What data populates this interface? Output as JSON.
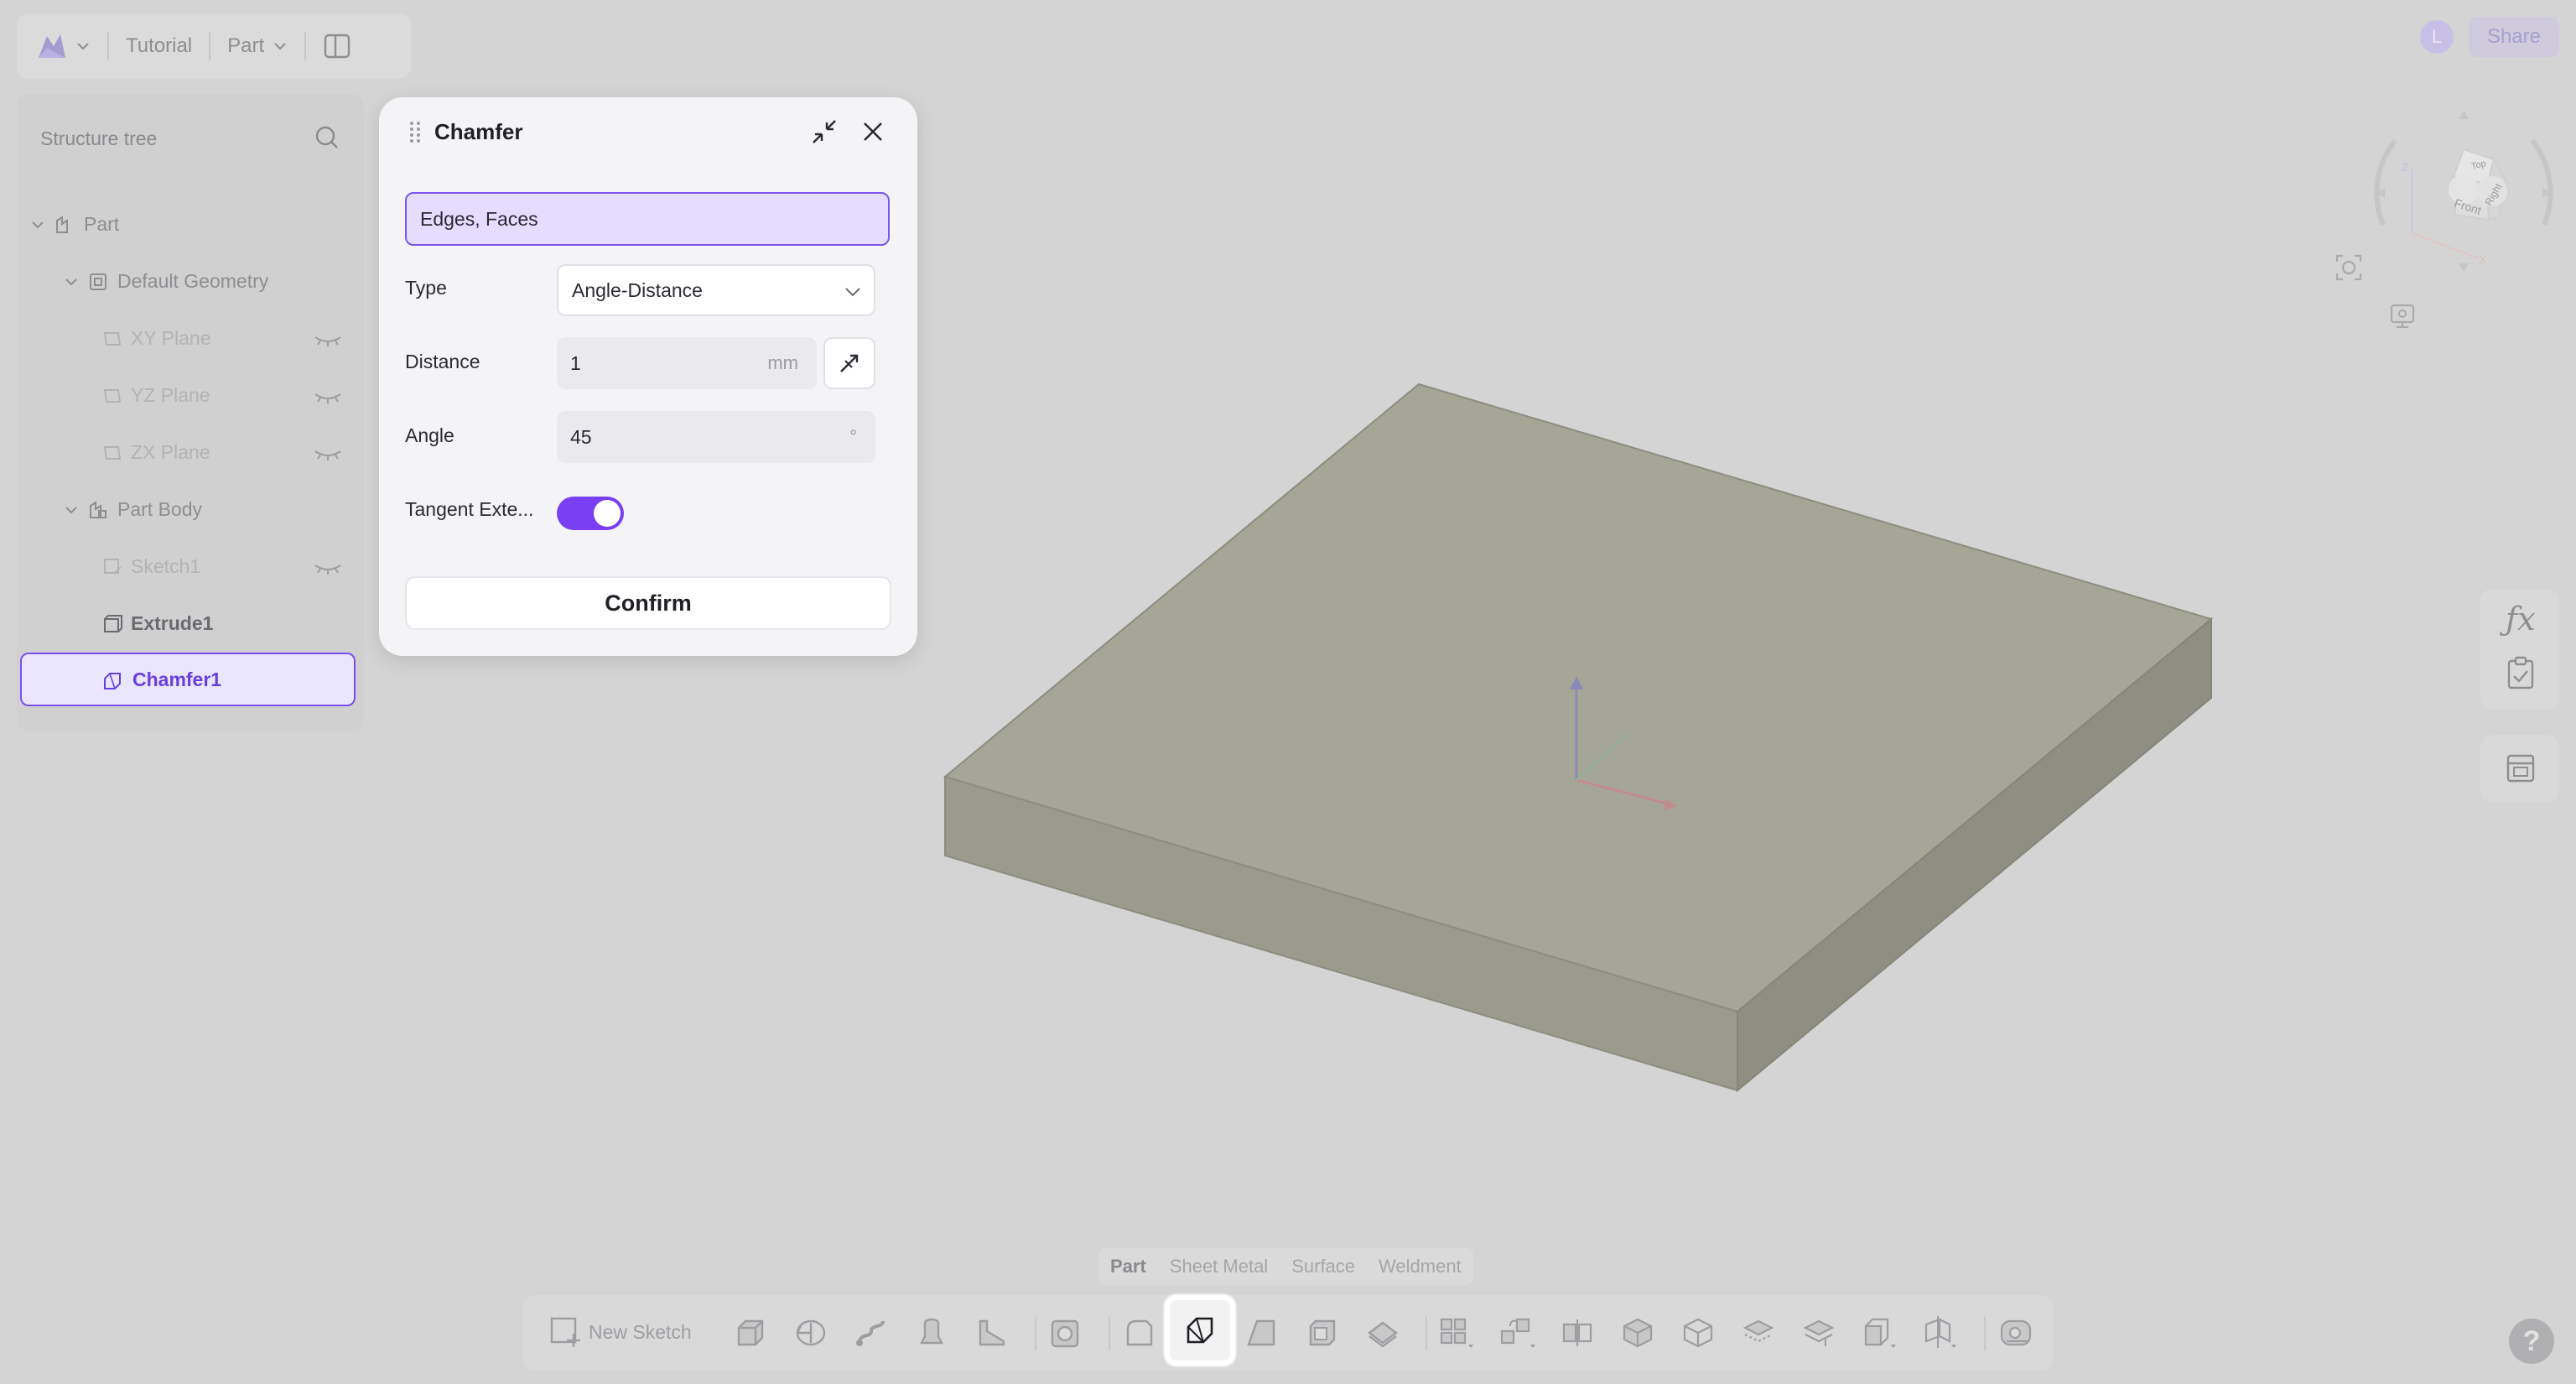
{
  "header": {
    "project": "Tutorial",
    "mode": "Part"
  },
  "tree": {
    "title": "Structure tree",
    "nodes": [
      {
        "label": "Part"
      },
      {
        "label": "Default Geometry"
      },
      {
        "label": "XY Plane"
      },
      {
        "label": "YZ Plane"
      },
      {
        "label": "ZX Plane"
      },
      {
        "label": "Part Body"
      },
      {
        "label": "Sketch1"
      },
      {
        "label": "Extrude1"
      },
      {
        "label": "Chamfer1"
      }
    ]
  },
  "dialog": {
    "title": "Chamfer",
    "selection": "Edges, Faces",
    "type_label": "Type",
    "type_value": "Angle-Distance",
    "distance_label": "Distance",
    "distance_value": "1",
    "distance_unit": "mm",
    "angle_label": "Angle",
    "angle_value": "45",
    "angle_unit": "°",
    "tangent_label": "Tangent Exte...",
    "tangent_on": true,
    "confirm_label": "Confirm"
  },
  "topright": {
    "avatar": "L",
    "share": "Share"
  },
  "viewcube": {
    "faces": [
      "Top",
      "Front",
      "Right"
    ],
    "axes": [
      "Z",
      "X"
    ]
  },
  "bottom": {
    "tabs": [
      "Part",
      "Sheet Metal",
      "Surface",
      "Weldment"
    ],
    "new_sketch": "New Sketch"
  },
  "colors": {
    "accent": "#7a3ff2",
    "overlay_bg": "#d4d4d4",
    "model": "#a5a596"
  }
}
